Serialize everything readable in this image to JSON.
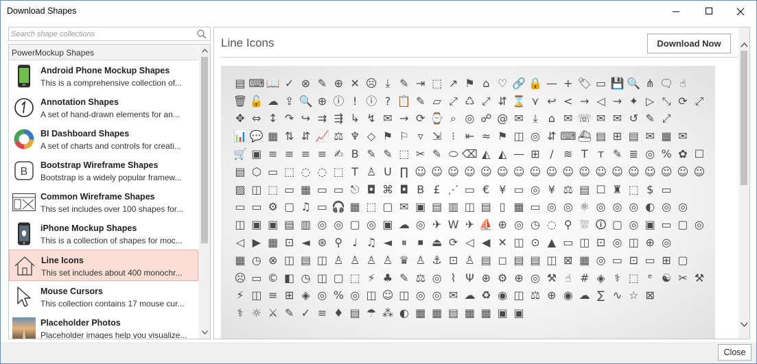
{
  "window": {
    "title": "Download Shapes"
  },
  "search": {
    "placeholder": "Search shape collections"
  },
  "collections": {
    "group_title": "PowerMockup Shapes",
    "items": [
      {
        "name": "Android Phone Mockup Shapes",
        "desc": "This is a comprehensive collection of...",
        "icon": "android-phone-icon"
      },
      {
        "name": "Annotation Shapes",
        "desc": "A set of hand-drawn elements for an...",
        "icon": "annotation-icon"
      },
      {
        "name": "BI Dashboard Shapes",
        "desc": "A set of charts and controls for creati...",
        "icon": "donut-chart-icon"
      },
      {
        "name": "Bootstrap Wireframe Shapes",
        "desc": "Bootstrap is a widely popular framew...",
        "icon": "bootstrap-icon"
      },
      {
        "name": "Common Wireframe Shapes",
        "desc": "This set includes over 100 shapes for...",
        "icon": "wireframe-icon"
      },
      {
        "name": "iPhone Mockup Shapes",
        "desc": "This is a collection of shapes for moc...",
        "icon": "iphone-icon"
      },
      {
        "name": "Line Icons",
        "desc": "This set includes about 400 monochr...",
        "icon": "house-line-icon",
        "selected": true
      },
      {
        "name": "Mouse Cursors",
        "desc": "This collection contains 17 mouse cur...",
        "icon": "cursor-icon"
      },
      {
        "name": "Placeholder Photos",
        "desc": "Placeholder images help you visualize...",
        "icon": "photo-icon"
      }
    ]
  },
  "detail": {
    "title": "Line Icons",
    "download_label": "Download Now",
    "preview_rows": [
      "▤⌨📖✓⊗✎⊕✕☹⤓✎⇥⬚↗⚑⌂♡🔗🔒—+🏷▭💾🔍⋔🗨☝",
      "🗑🔓☁⇪🔍⊕ⓘ!ⓘ?📋✎▱⤢♺⤢⇵⌛⋎↩<→◁→✦▷⤡⟳⤢",
      "✥⇔↕↷↪⇉⇶↳↯✉→⟳⌚⌕◎☍@✉⤓⌂✉☏✉✉↺✎⤢",
      "📊💬▦⇅⇵📈⚖♆◇⚑⚐▿⇲⁝⇤≈⚑◫◎⇵⌨⛴▤⊞▤✉▦✉",
      "🛒▣≡≡≡≡✍B✎✎⬚✂✎⬭⌫◭◭—⊞/≋Tт✎≣◎%✿☐",
      "▤⬡▭⬚◌◌⬚T♙U∏☺☺☺☺☺☺☺☺☺☺☺☺☺☺☺☺☺☺",
      "▨◫⬚▭▦▭▭⎋◘⌘◘B£⋰▭€¥▭◎¥⚖▤☐♜⬚$▭",
      "▭▭⚙▢♫▭🎧▦⬚▢✉▣▤▥◫▤▯▦▭◎◎⚛◎◎◎◐◎◎",
      "◫▣▣▤▥◎◎▢◎▣☁◎✈W✈⛵⊕◎◷◌⚲⛆🛈▢◎▣▭▢◎",
      "◁▶▦⊡◄⊛⚲♩♫◄⏸⏹⏏⟳◁◀✕◫⊙▲▭◫⊡◎◫⊕◎",
      "▦◷⊗◫▤◫♙♙♙♙♛♙⚓⊡♙▤◻▤▤◫⊠▦◎▭⊡▭⊞▢",
      "☹▭©◧◷◫▢⬚⚡♣✎⚖◎⌇Ψ⊕⚙⊕◎⚒☝#◈⚕⬚ᵉ☯✂⚒",
      "⚡◫≡⊞◈◎%◎◫☺◫◎◎✉☁♻◉◫⚖⊕◉☁∑∿☆⊠",
      "⚕☼⚔✎✓≡♦▤☂⁂◐▦▦▤▦▦▣▣"
    ]
  },
  "footer": {
    "close_label": "Close"
  }
}
